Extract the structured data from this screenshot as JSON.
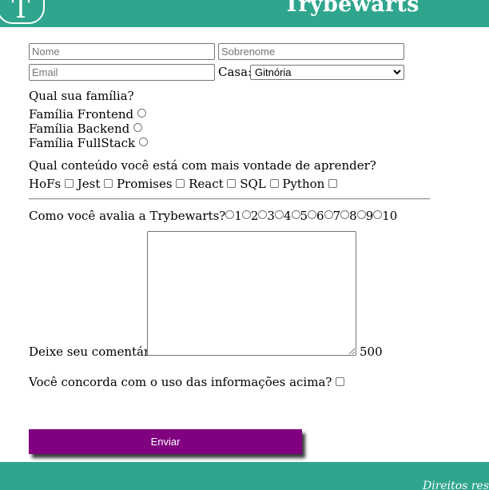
{
  "header": {
    "logo_letter": "T",
    "title": "Trybewarts"
  },
  "form": {
    "name_placeholder": "Nome",
    "lastname_placeholder": "Sobrenome",
    "email_placeholder": "Email",
    "house_label": "Casa:",
    "house_selected": "Gitnória",
    "family_question": "Qual sua família?",
    "families": [
      "Família Frontend",
      "Família Backend",
      "Família FullStack"
    ],
    "content_question": "Qual conteúdo você está com mais vontade de aprender?",
    "subjects": [
      "HoFs",
      "Jest",
      "Promises",
      "React",
      "SQL",
      "Python"
    ],
    "rating_question": "Como você avalia a Trybewarts?",
    "ratings": [
      "1",
      "2",
      "3",
      "4",
      "5",
      "6",
      "7",
      "8",
      "9",
      "10"
    ],
    "comment_label": "Deixe seu comentário:",
    "char_counter": "500",
    "agreement_label": "Você concorda com o uso das informações acima?",
    "submit_label": "Enviar"
  },
  "footer": {
    "text": "Direitos rese"
  },
  "colors": {
    "header_bg": "#2fa58d",
    "button_bg": "#800080"
  }
}
